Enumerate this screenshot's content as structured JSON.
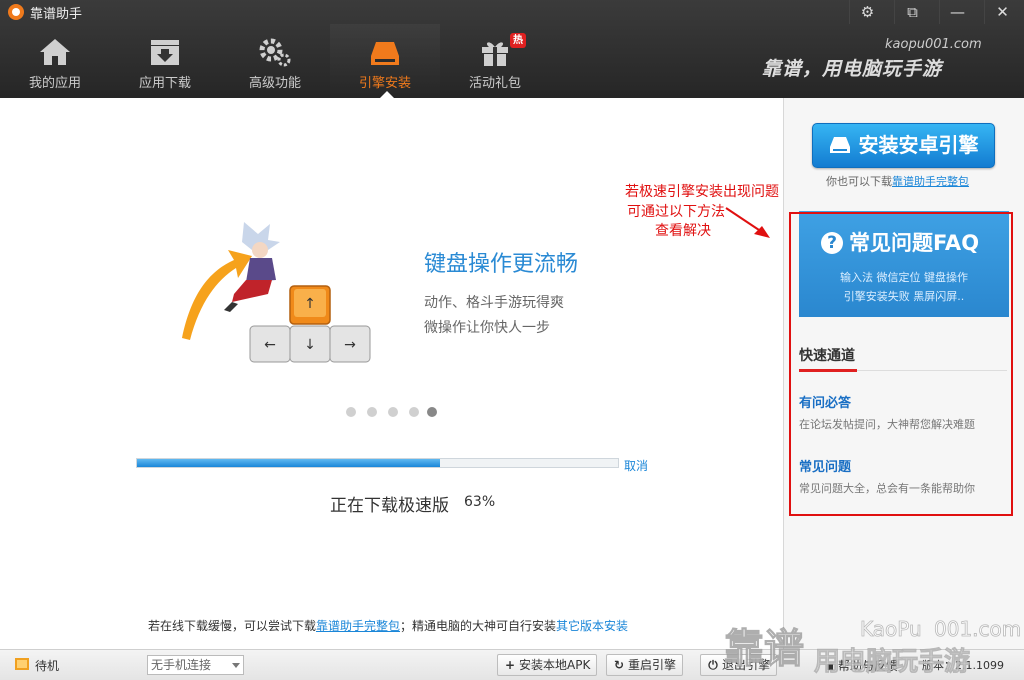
{
  "window": {
    "title": "靠谱助手",
    "controls": [
      "⚙",
      "⧉",
      "—",
      "✕"
    ]
  },
  "nav": {
    "tabs": [
      {
        "label": "我的应用",
        "icon": "home-icon"
      },
      {
        "label": "应用下载",
        "icon": "download-box-icon"
      },
      {
        "label": "高级功能",
        "icon": "gears-icon"
      },
      {
        "label": "引擎安装",
        "icon": "hard-drive-icon",
        "active": true
      },
      {
        "label": "活动礼包",
        "icon": "gift-icon",
        "badge": "热"
      }
    ]
  },
  "header": {
    "site": "kaopu001.com",
    "slogan": "靠谱，用电脑玩手游"
  },
  "main": {
    "banner": {
      "title": "键盘操作更流畅",
      "lines": [
        "动作、格斗手游玩得爽",
        "微操作让你快人一步"
      ],
      "keys": [
        "↑",
        "←",
        "↓",
        "→"
      ]
    },
    "carousel": {
      "count": 5,
      "active_index": 4
    },
    "download": {
      "progress_percent": 63,
      "cancel_label": "取消",
      "status": "正在下载极速版",
      "percent_label": "63%"
    },
    "tip": {
      "prefix": "若在线下载缓慢，可以尝试下载",
      "link1": "靠谱助手完整包",
      "middle": "；精通电脑的大神可自行安装",
      "link2": "其它版本安装"
    }
  },
  "sidebar": {
    "install_button": "安装安卓引擎",
    "alt_prefix": "你也可以下载",
    "alt_link": "靠谱助手完整包",
    "faq": {
      "title": "常见问题FAQ",
      "line1": "输入法  微信定位  键盘操作",
      "line2": "引擎安装失败  黑屏闪屏.."
    },
    "quick": {
      "title": "快速通道",
      "items": [
        {
          "title": "有问必答",
          "desc": "在论坛发帖提问，大神帮您解决难题"
        },
        {
          "title": "常见问题",
          "desc": "常见问题大全，总会有一条能帮助你"
        }
      ]
    }
  },
  "annotation": {
    "lines": [
      "若极速引擎安装出现问题",
      "可通过以下方法",
      "查看解决"
    ]
  },
  "statusbar": {
    "standby": "待机",
    "device_select": "无手机连接",
    "buttons": [
      {
        "label": "安装本地APK",
        "icon": "+"
      },
      {
        "label": "重启引擎",
        "icon": "↻"
      },
      {
        "label": "退出引擎",
        "icon": "⏻"
      }
    ],
    "help": "帮助与反馈",
    "version": "版本：2.1.1099"
  },
  "watermark": {
    "text1": "靠谱",
    "text2": "KaoPu",
    "text3": "001.com",
    "text4": "用电脑玩手游"
  },
  "colors": {
    "accent_orange": "#f07a1c",
    "link_blue": "#1a86d8",
    "annotation_red": "#e01010"
  }
}
